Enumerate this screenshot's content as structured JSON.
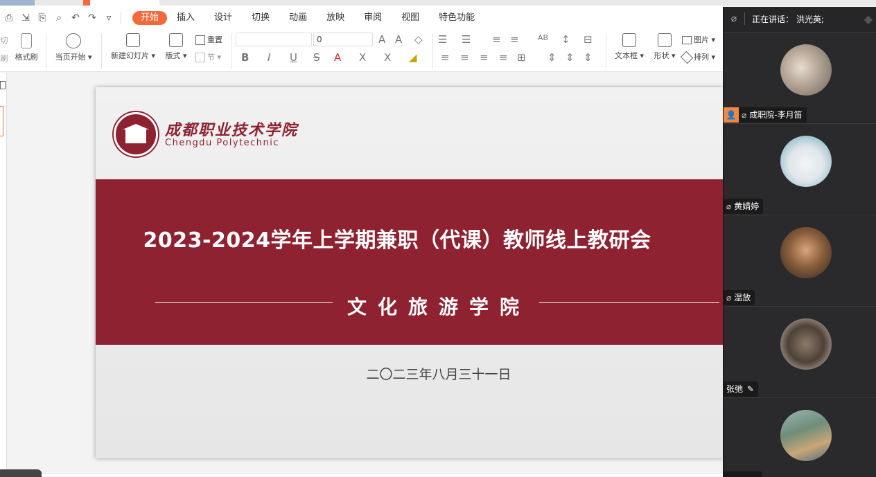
{
  "menu": {
    "tabs": [
      "开始",
      "插入",
      "设计",
      "切换",
      "动画",
      "放映",
      "审阅",
      "视图",
      "特色功能"
    ],
    "active_tab": "开始"
  },
  "ribbon": {
    "cut_label": "切",
    "brush_partial_label": "刷",
    "format_painter": "格式刷",
    "play_current": "当页开始 ▾",
    "new_slide": "新建幻灯片 ▾",
    "layout": "版式 ▾",
    "reset": "重置",
    "section": "节 ▾",
    "font_name": "",
    "font_size": "0",
    "textbox": "文本框 ▾",
    "shape": "形状 ▾",
    "picture": "图片 ▾",
    "arrange": "排列 ▾"
  },
  "slide": {
    "school_cn": "成都职业技术学院",
    "school_en": "Chengdu Polytechnic",
    "title": "2023-2024学年上学期兼职（代课）教师线上教研会",
    "department": "文化旅游学院",
    "date": "二〇二三年八月三十一日"
  },
  "meeting": {
    "speaking_label": "正在讲话：",
    "speaking_name": "洪光英;",
    "participants": [
      {
        "name": "成职院-李月笛",
        "host": true
      },
      {
        "name": "黄婧婷"
      },
      {
        "name": "温放"
      },
      {
        "name": "张弛"
      },
      {
        "name": ""
      }
    ]
  },
  "colors": {
    "accent": "#f26a3c",
    "slide_band": "#8e2230",
    "meeting_bg": "#262628"
  }
}
